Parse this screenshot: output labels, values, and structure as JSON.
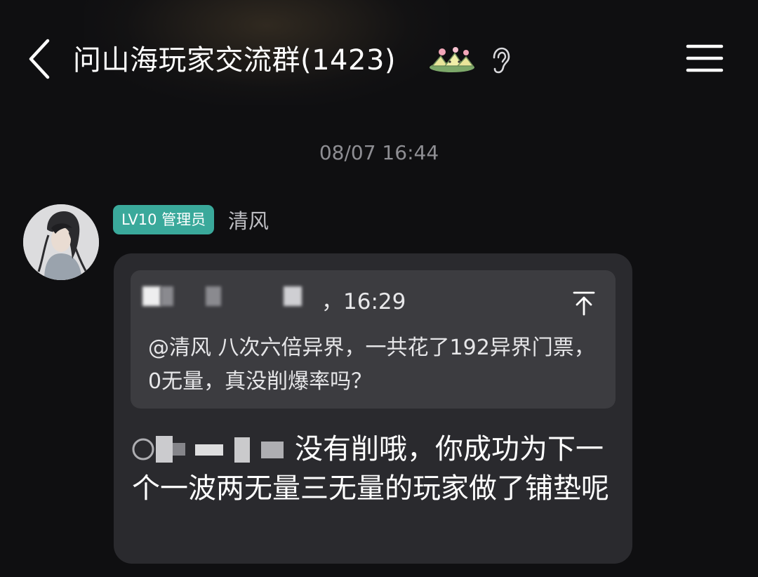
{
  "header": {
    "title": "问山海玩家交流群(1423)",
    "back_icon": "chevron-left-icon",
    "badge_icon": "group-emblem-icon",
    "ear_icon": "ear-icon",
    "menu_icon": "hamburger-menu-icon"
  },
  "chat": {
    "timestamp": "08/07 16:44",
    "message": {
      "role_badge": "LV10 管理员",
      "sender": "清风",
      "quote": {
        "time": "，16:29",
        "text": "@清风 八次六倍异界，一共花了192异界门票，0无量，真没削爆率吗？"
      },
      "reply": "没有削哦，你成功为下一个一波两无量三无量的玩家做了铺垫呢"
    }
  },
  "colors": {
    "background": "#0f0f11",
    "bubble": "#2a2a2e",
    "quote_bg": "#3c3c40",
    "badge": "#3aa99b",
    "muted": "#8e8e93"
  }
}
